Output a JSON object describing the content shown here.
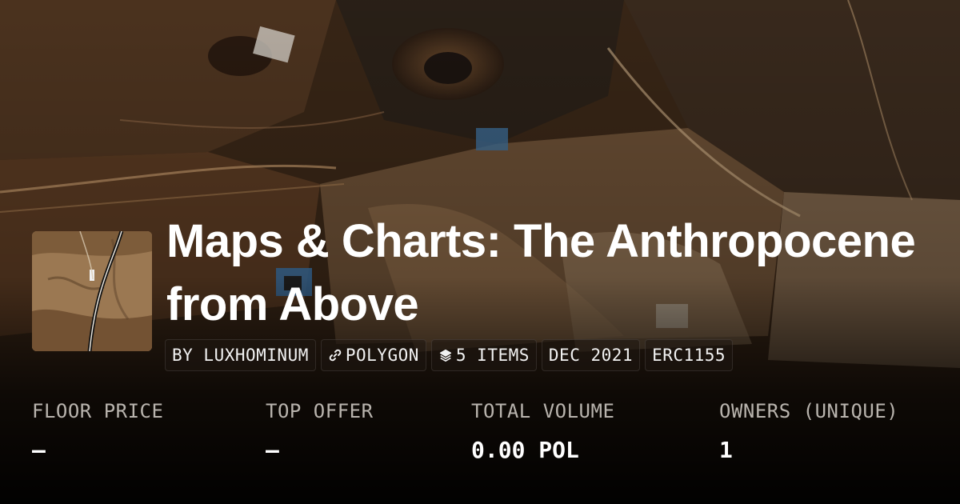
{
  "collection": {
    "title_line1": "Maps & Charts: The Anthropocene",
    "title_line2": "from Above"
  },
  "chips": {
    "creator": "BY LUXHOMINUM",
    "chain": "POLYGON",
    "items": "5 ITEMS",
    "date": "DEC 2021",
    "standard": "ERC1155"
  },
  "icons": {
    "chain": "link-icon",
    "items": "layers-icon"
  },
  "stats": {
    "floor_label": "FLOOR PRICE",
    "floor_value": "—",
    "offer_label": "TOP OFFER",
    "offer_value": "—",
    "volume_label": "TOTAL VOLUME",
    "volume_value": "0.00 POL",
    "owners_label": "OWNERS (UNIQUE)",
    "owners_value": "1"
  }
}
